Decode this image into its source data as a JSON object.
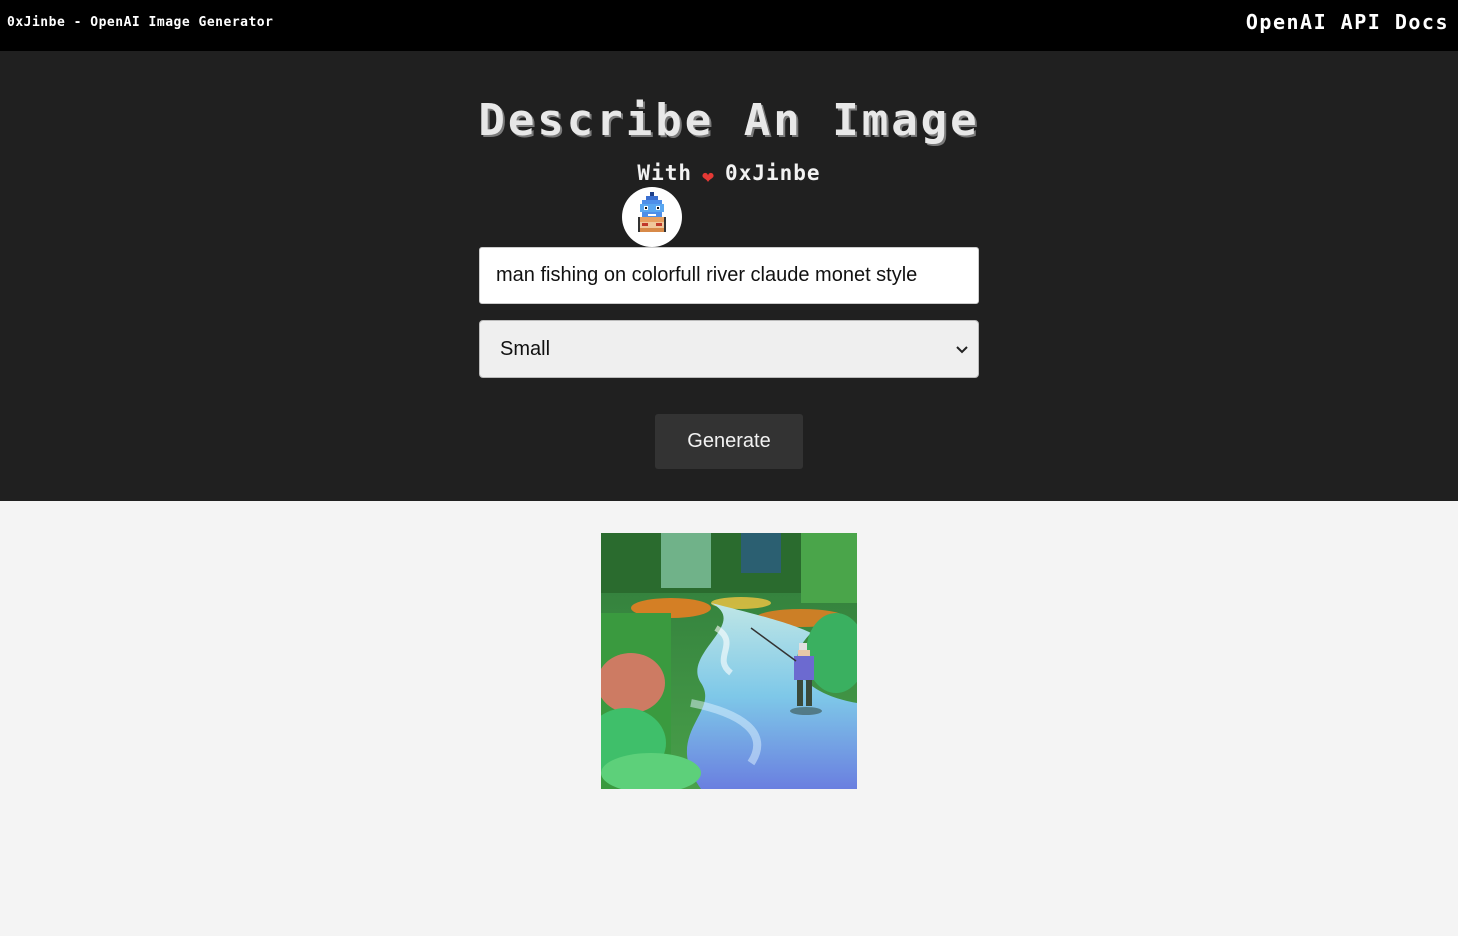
{
  "nav": {
    "brand": "0xJinbe - OpenAI Image Generator",
    "docs_link": "OpenAI API Docs"
  },
  "hero": {
    "title": "Describe An Image",
    "subtitle_prefix": "With",
    "subtitle_heart": "❤",
    "subtitle_author": "0xJinbe"
  },
  "form": {
    "prompt_value": "man fishing on colorfull river claude monet style",
    "size_selected": "Small",
    "generate_label": "Generate"
  },
  "colors": {
    "navbar": "#000000",
    "hero": "#202020",
    "page": "#f4f4f4",
    "heart": "#e53935",
    "button": "#333333"
  },
  "icons": {
    "heart": "heart-icon",
    "avatar": "pixel-fishman-avatar",
    "select": "chevron-down-icon"
  }
}
